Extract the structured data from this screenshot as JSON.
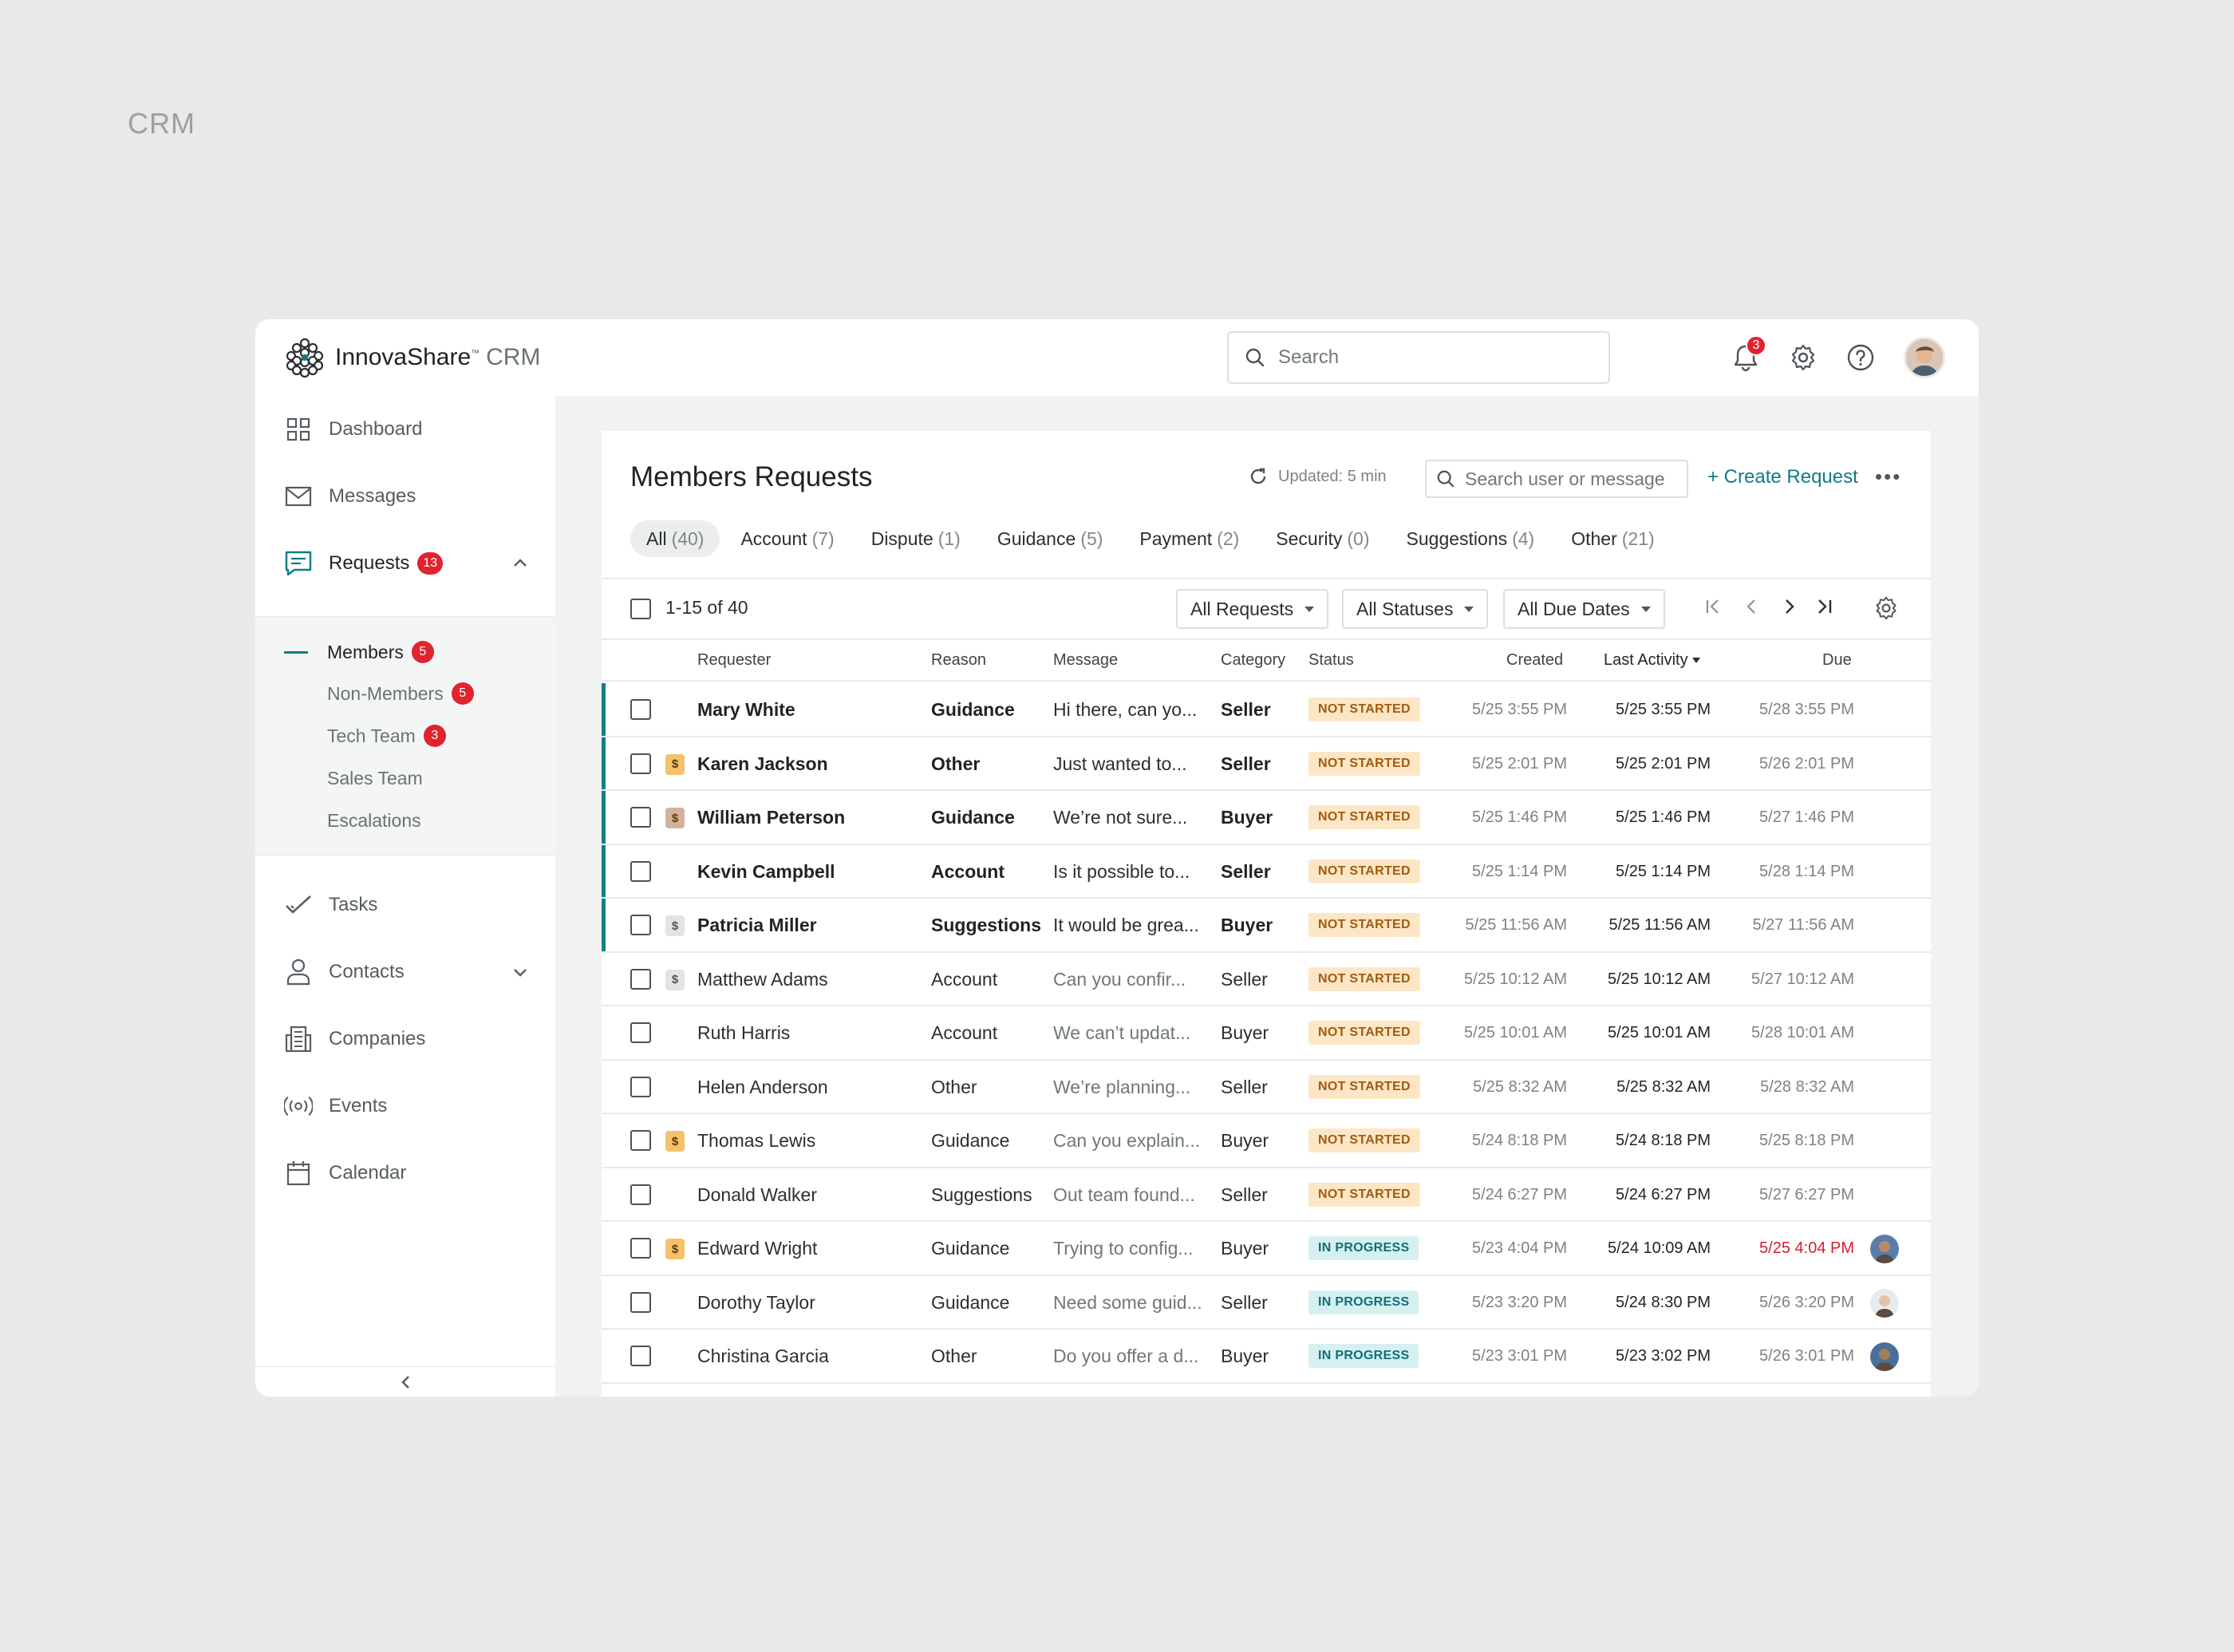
{
  "caption": "CRM",
  "header": {
    "brand": "InnovaShare",
    "brand_tm": "™",
    "brand_suffix": "CRM",
    "search_placeholder": "Search",
    "notification_count": "3"
  },
  "sidebar": {
    "items": [
      {
        "label": "Dashboard",
        "icon": "grid-icon"
      },
      {
        "label": "Messages",
        "icon": "envelope-icon"
      },
      {
        "label": "Requests",
        "icon": "chat-list-icon",
        "badge": "13"
      },
      {
        "label": "Tasks",
        "icon": "check-icon"
      },
      {
        "label": "Contacts",
        "icon": "person-icon"
      },
      {
        "label": "Companies",
        "icon": "building-icon"
      },
      {
        "label": "Events",
        "icon": "broadcast-icon"
      },
      {
        "label": "Calendar",
        "icon": "calendar-icon"
      }
    ],
    "sub_items": [
      {
        "label": "Members",
        "badge": "5"
      },
      {
        "label": "Non-Members",
        "badge": "5"
      },
      {
        "label": "Tech Team",
        "badge": "3"
      },
      {
        "label": "Sales Team"
      },
      {
        "label": "Escalations"
      }
    ]
  },
  "panel": {
    "title": "Members Requests",
    "updated": "Updated: 5 min",
    "search_placeholder": "Search user or message",
    "create_label": "+ Create Request",
    "more_label": "•••",
    "tabs": [
      {
        "label": "All",
        "count": "(40)"
      },
      {
        "label": "Account",
        "count": "(7)"
      },
      {
        "label": "Dispute",
        "count": "(1)"
      },
      {
        "label": "Guidance",
        "count": "(5)"
      },
      {
        "label": "Payment",
        "count": "(2)"
      },
      {
        "label": "Security",
        "count": "(0)"
      },
      {
        "label": "Suggestions",
        "count": "(4)"
      },
      {
        "label": "Other",
        "count": "(21)"
      }
    ],
    "range": "1-15 of 40",
    "filters": {
      "requests": "All Requests",
      "statuses": "All Statuses",
      "due": "All Due Dates"
    },
    "columns": {
      "requester": "Requester",
      "reason": "Reason",
      "message": "Message",
      "category": "Category",
      "status": "Status",
      "created": "Created",
      "last_activity": "Last Activity",
      "due": "Due"
    },
    "rows": [
      {
        "name": "Mary White",
        "reason": "Guidance",
        "message": "Hi there, can yo...",
        "category": "Seller",
        "status": "NOT STARTED",
        "created": "5/25 3:55 PM",
        "last": "5/25 3:55 PM",
        "due": "5/28 3:55 PM"
      },
      {
        "name": "Karen Jackson",
        "reason": "Other",
        "message": "Just wanted to...",
        "category": "Seller",
        "status": "NOT STARTED",
        "created": "5/25 2:01 PM",
        "last": "5/25 2:01 PM",
        "due": "5/26 2:01 PM"
      },
      {
        "name": "William Peterson",
        "reason": "Guidance",
        "message": "We’re not sure...",
        "category": "Buyer",
        "status": "NOT STARTED",
        "created": "5/25 1:46 PM",
        "last": "5/25 1:46 PM",
        "due": "5/27 1:46 PM"
      },
      {
        "name": "Kevin Campbell",
        "reason": "Account",
        "message": "Is it possible to...",
        "category": "Seller",
        "status": "NOT STARTED",
        "created": "5/25 1:14 PM",
        "last": "5/25 1:14 PM",
        "due": "5/28 1:14 PM"
      },
      {
        "name": "Patricia Miller",
        "reason": "Suggestions",
        "message": "It would be grea...",
        "category": "Buyer",
        "status": "NOT STARTED",
        "created": "5/25 11:56 AM",
        "last": "5/25 11:56 AM",
        "due": "5/27 11:56 AM"
      },
      {
        "name": "Matthew Adams",
        "reason": "Account",
        "message": "Can you confir...",
        "category": "Seller",
        "status": "NOT STARTED",
        "created": "5/25 10:12 AM",
        "last": "5/25 10:12 AM",
        "due": "5/27 10:12 AM"
      },
      {
        "name": "Ruth Harris",
        "reason": "Account",
        "message": "We can’t updat...",
        "category": "Buyer",
        "status": "NOT STARTED",
        "created": "5/25 10:01 AM",
        "last": "5/25 10:01 AM",
        "due": "5/28 10:01 AM"
      },
      {
        "name": "Helen Anderson",
        "reason": "Other",
        "message": "We’re planning...",
        "category": "Seller",
        "status": "NOT STARTED",
        "created": "5/25 8:32 AM",
        "last": "5/25 8:32 AM",
        "due": "5/28 8:32 AM"
      },
      {
        "name": "Thomas Lewis",
        "reason": "Guidance",
        "message": "Can you explain...",
        "category": "Buyer",
        "status": "NOT STARTED",
        "created": "5/24 8:18 PM",
        "last": "5/24 8:18 PM",
        "due": "5/25 8:18 PM"
      },
      {
        "name": "Donald Walker",
        "reason": "Suggestions",
        "message": "Out team found...",
        "category": "Seller",
        "status": "NOT STARTED",
        "created": "5/24 6:27 PM",
        "last": "5/24 6:27 PM",
        "due": "5/27 6:27 PM"
      },
      {
        "name": "Edward Wright",
        "reason": "Guidance",
        "message": "Trying to config...",
        "category": "Buyer",
        "status": "IN PROGRESS",
        "created": "5/23 4:04 PM",
        "last": "5/24 10:09 AM",
        "due": "5/25 4:04 PM"
      },
      {
        "name": "Dorothy Taylor",
        "reason": "Guidance",
        "message": "Need some guid...",
        "category": "Seller",
        "status": "IN PROGRESS",
        "created": "5/23 3:20 PM",
        "last": "5/24 8:30 PM",
        "due": "5/26 3:20 PM"
      },
      {
        "name": "Christina Garcia",
        "reason": "Other",
        "message": "Do you offer a d...",
        "category": "Buyer",
        "status": "IN PROGRESS",
        "created": "5/23 3:01 PM",
        "last": "5/23 3:02 PM",
        "due": "5/26 3:01 PM"
      }
    ]
  },
  "colors": {
    "accent": "#0e7c86",
    "badge": "#e0232e",
    "not_started_bg": "#fde6c6",
    "in_progress_bg": "#d6f0f1",
    "overdue": "#d3212c"
  }
}
